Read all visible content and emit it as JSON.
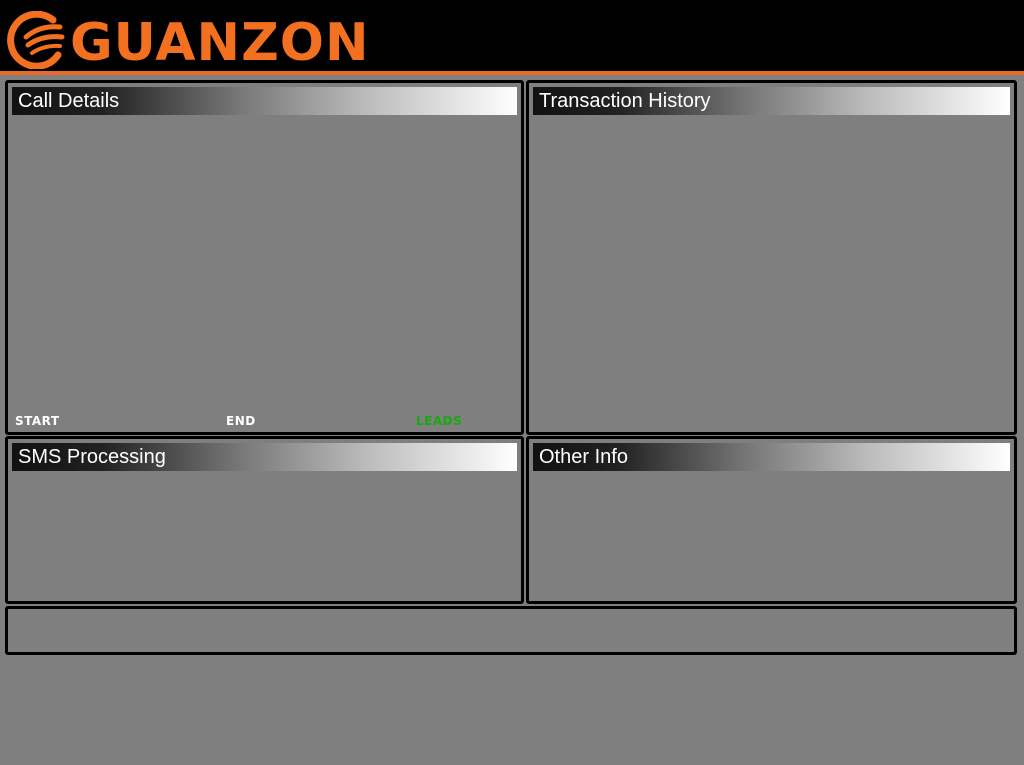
{
  "brand": {
    "name": "GUANZON",
    "logo_icon": "guanzon-swoosh-logo",
    "color": "#f37021",
    "header_line_color": "#e8692a"
  },
  "panels": {
    "call_details": {
      "title": "Call Details",
      "footer": {
        "start_label": "START",
        "end_label": "END",
        "leads_label": "LEADS",
        "leads_color": "#18a80f"
      }
    },
    "transaction_history": {
      "title": "Transaction History"
    },
    "sms_processing": {
      "title": "SMS Processing"
    },
    "other_info": {
      "title": "Other Info"
    }
  },
  "colors": {
    "background": "#7f7f7f",
    "header": "#000000",
    "panel_border": "#000000"
  }
}
